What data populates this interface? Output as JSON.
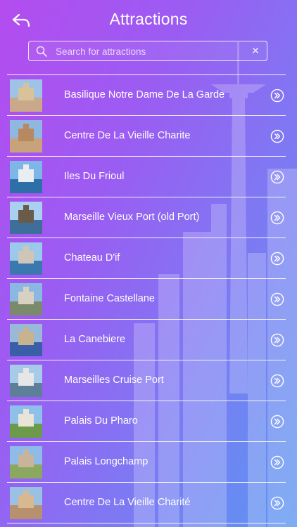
{
  "header": {
    "title": "Attractions",
    "back_icon": "back-arrow-icon"
  },
  "search": {
    "placeholder": "Search for attractions",
    "value": "",
    "search_icon": "search-icon",
    "clear_icon": "clear-icon"
  },
  "attractions": [
    {
      "label": "Basilique Notre Dame De La Garde"
    },
    {
      "label": "Centre De La Vieille Charite"
    },
    {
      "label": "Iles Du Frioul"
    },
    {
      "label": "Marseille Vieux Port (old Port)"
    },
    {
      "label": "Chateau D'if"
    },
    {
      "label": "Fontaine Castellane"
    },
    {
      "label": "La Canebiere"
    },
    {
      "label": "Marseilles Cruise Port"
    },
    {
      "label": "Palais Du Pharo"
    },
    {
      "label": "Palais Longchamp"
    },
    {
      "label": "Centre De La Vieille Charité"
    }
  ],
  "colors": {
    "gradient_start": "#b44cf0",
    "gradient_end": "#5a96f2",
    "text": "#ffffff"
  }
}
